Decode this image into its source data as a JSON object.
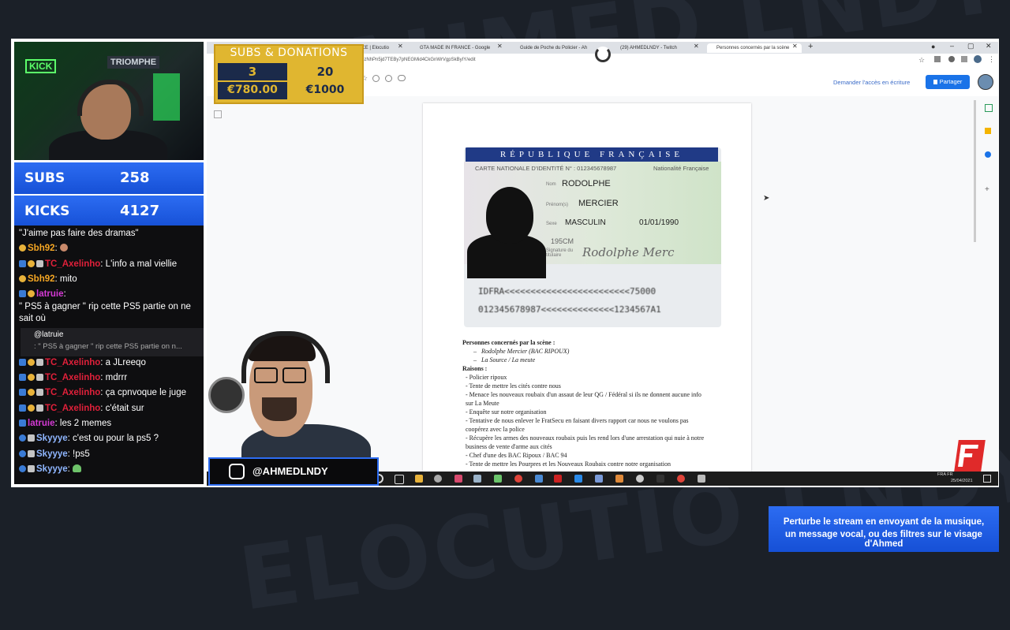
{
  "overlay": {
    "donations_title": "SUBS & DONATIONS",
    "subs_count": "3",
    "sub_goal": "20",
    "donation_amount": "€780.00",
    "donation_goal": "€1000",
    "subs_label": "SUBS",
    "subs_value": "258",
    "kicks_label": "KICKS",
    "kicks_value": "4127",
    "instagram_handle": "@AHMEDLNDY",
    "promo_line1": "Perturbe le stream en envoyant de la musique,",
    "promo_line2": "un message vocal, ou des filtres sur le visage d'Ahmed"
  },
  "webcam": {
    "neon_sign": "KICK",
    "wall_sign": "TRIOMPHE"
  },
  "chat": {
    "messages": [
      {
        "user": "",
        "text": "\"J'aime pas faire des dramas\""
      },
      {
        "user": "Sbh92",
        "text": ":"
      },
      {
        "user": "TC_Axelinho",
        "text": ": L'info a mal viellie"
      },
      {
        "user": "Sbh92",
        "text": ": mito"
      },
      {
        "user": "latruie",
        "text": ":"
      },
      {
        "user": "",
        "text": "\" PS5 à gagner \" rip cette PS5 partie on ne sait où"
      },
      {
        "user": "TC_Axelinho",
        "text": ": a JLreeqo"
      },
      {
        "user": "TC_Axelinho",
        "text": ": mdrrr"
      },
      {
        "user": "TC_Axelinho",
        "text": ": ça cpnvoque le juge"
      },
      {
        "user": "TC_Axelinho",
        "text": ": c'était sur"
      },
      {
        "user": "latruie",
        "text": ": les 2 memes"
      },
      {
        "user": "Skyyye",
        "text": ": c'est ou pour la ps5 ?"
      },
      {
        "user": "Skyyye",
        "text": ": !ps5"
      },
      {
        "user": "Skyyye",
        "text": ":"
      }
    ],
    "reply_user": "@latruie",
    "reply_text": ": \" PS5 à gagner \" rip cette PS5 partie on n..."
  },
  "browser": {
    "tabs": [
      {
        "label": "NCE | Elocutio"
      },
      {
        "label": "GTA MADE IN FRANCE - Google"
      },
      {
        "label": "Guide de Poche du Policier - Ah"
      },
      {
        "label": "(29) AHMEDLNDY - Twitch"
      },
      {
        "label": "Personnes concernés par la scène"
      }
    ],
    "url": "0zNhPn5jd7TEBy7pNEGMid4CkGnWrVgpSkByIY/edit",
    "request_access": "Demander l'accès en écriture",
    "share": "Partager"
  },
  "id_card": {
    "header": "RÉPUBLIQUE FRANÇAISE",
    "subheader": "CARTE NATIONALE D'IDENTITÉ N° : 012345678987",
    "nationality": "Nationalité Française",
    "nom_label": "Nom",
    "nom": "RODOLPHE",
    "prenom_label": "Prénom(s)",
    "prenom": "MERCIER",
    "sexe_label": "Sexe",
    "sexe": "MASCULIN",
    "dob": "01/01/1990",
    "taille": "195CM",
    "signature_label": "Signature du titulaire",
    "signature": "Rodolphe Merc",
    "mrz1": "IDFRA<<<<<<<<<<<<<<<<<<<<<<<<75000",
    "mrz2": "012345678987<<<<<<<<<<<<<<1234567A1"
  },
  "document": {
    "heading1": "Personnes concernés par la scène :",
    "persons": [
      "Rodolphe Mercier (BAC RIPOUX)",
      "La Source / La meute"
    ],
    "heading2": "Raisons :",
    "reasons": [
      "-  Policier ripoux",
      "-  Tente de mettre les cités contre nous",
      "-  Menace les nouveaux roubaix d'un assaut de leur QG / Fédéral si ils ne donnent aucune info sur La Meute",
      "- Enquête sur notre organisation",
      "- Tentative de nous enlever le FratSecu en faisant divers rapport car nous ne voulons pas coopérez avec la police",
      "- Récupère les armes des nouveaux roubaix puis les rend lors d'une arrestation qui nuie à notre business de vente d'arme aux cités",
      "- Chef d'une des BAC Ripoux / BAC 94",
      "- Tente de mettre les Pourpres et les Nouveaux Roubaix contre notre organisation"
    ]
  },
  "taskbar": {
    "lang": "FRA FR",
    "date": "25/04/2021"
  }
}
